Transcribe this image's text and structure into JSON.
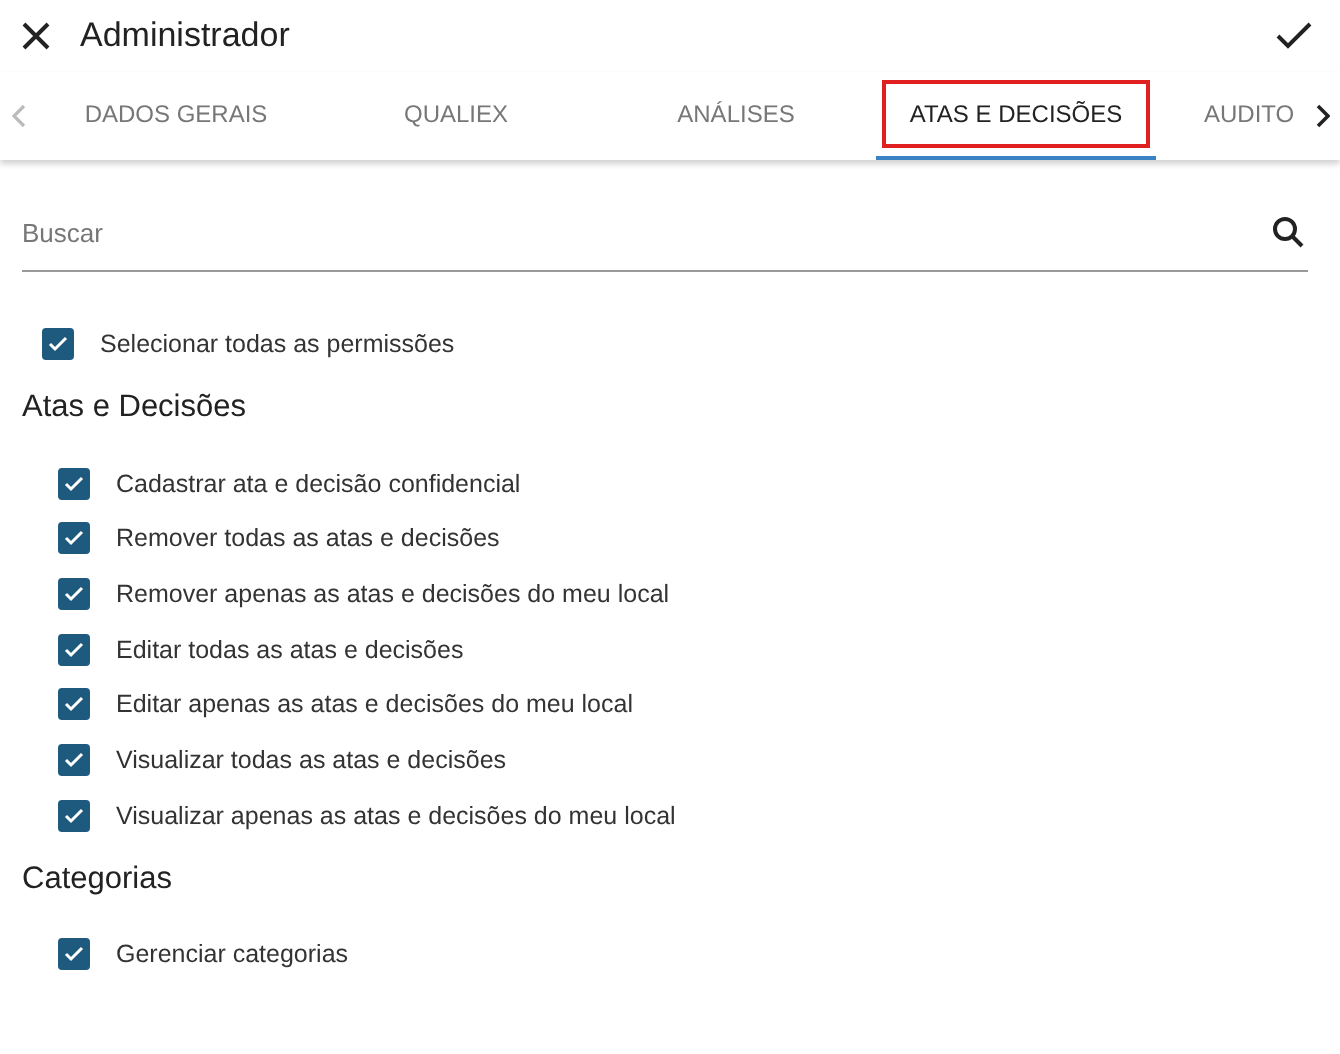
{
  "header": {
    "title": "Administrador"
  },
  "tabs": [
    {
      "label": "DADOS GERAIS",
      "selected": false
    },
    {
      "label": "QUALIEX",
      "selected": false
    },
    {
      "label": "ANÁLISES",
      "selected": false
    },
    {
      "label": "ATAS E DECISÕES",
      "selected": true
    },
    {
      "label": "AUDITO",
      "selected": false
    }
  ],
  "search": {
    "placeholder": "Buscar"
  },
  "select_all": {
    "label": "Selecionar todas as permissões",
    "checked": true
  },
  "sections": [
    {
      "title": "Atas e Decisões",
      "permissions": [
        {
          "label": "Cadastrar ata e decisão confidencial",
          "checked": true
        },
        {
          "label": "Remover todas as atas e decisões",
          "checked": true
        },
        {
          "label": "Remover apenas as atas e decisões do meu local",
          "checked": true
        },
        {
          "label": "Editar todas as atas e decisões",
          "checked": true
        },
        {
          "label": "Editar apenas as atas e decisões do meu local",
          "checked": true
        },
        {
          "label": "Visualizar todas as atas e decisões",
          "checked": true
        },
        {
          "label": "Visualizar apenas as atas e decisões do meu local",
          "checked": true
        }
      ]
    },
    {
      "title": "Categorias",
      "permissions": [
        {
          "label": "Gerenciar categorias",
          "checked": true
        }
      ]
    }
  ]
}
